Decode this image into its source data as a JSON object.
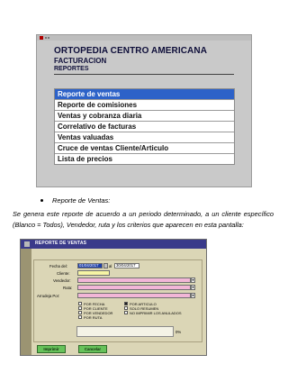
{
  "menu_screen": {
    "company": "ORTOPEDIA CENTRO AMERICANA",
    "module": "FACTURACION",
    "section": "REPORTES",
    "items": [
      {
        "label": "Reporte de ventas",
        "selected": true
      },
      {
        "label": "Reporte de comisiones",
        "selected": false
      },
      {
        "label": "Ventas y cobranza diaria",
        "selected": false
      },
      {
        "label": "Correlativo de facturas",
        "selected": false
      },
      {
        "label": "Ventas valuadas",
        "selected": false
      },
      {
        "label": "Cruce de ventas Cliente/Articulo",
        "selected": false
      },
      {
        "label": "Lista de precios",
        "selected": false
      }
    ],
    "selection_color": "#2d62c8"
  },
  "doc": {
    "bullet_title": "Reporte de Ventas",
    "bullet_suffix": ":",
    "paragraph": "Se genera este reporte de acuerdo a un periodo determinado, a un cliente específico (Blanco = Todos), Vendedor, ruta y los criterios que aparecen en esta pantalla:"
  },
  "report_form": {
    "title": "REPORTE DE VENTAS",
    "fecha_label": "Fecha del:",
    "fecha_from": "01/04/2017",
    "fecha_to_label": "al",
    "fecha_to": "30/04/2017",
    "cliente_label": "Cliente:",
    "vendedor_label": "Vendedor:",
    "ruta_label": "Ruta:",
    "agrupado_label": "Arrudeja Por:",
    "options": [
      {
        "label": "POR FECHA",
        "checked": false
      },
      {
        "label": "POR ARTICULO",
        "checked": true
      },
      {
        "label": "POR CLIENTE",
        "checked": false
      },
      {
        "label": "SOLO RESUMEN",
        "checked": false
      },
      {
        "label": "POR VENDEDOR",
        "checked": false
      },
      {
        "label": "NO IMPRIMIR LOS ANULADOS",
        "checked": false
      },
      {
        "label": "POR RUTA",
        "checked": false
      }
    ],
    "progress_pct": "0%",
    "progress_value": 0,
    "print_button": "Imprimir",
    "cancel_button": "Cancelar",
    "colors": {
      "titlebar": "#3a3a8a",
      "background": "#dbd6b6",
      "buttons": "#66c25a",
      "pink_field": "#f2b6d7",
      "yellow_field": "#f6f4a4"
    }
  }
}
